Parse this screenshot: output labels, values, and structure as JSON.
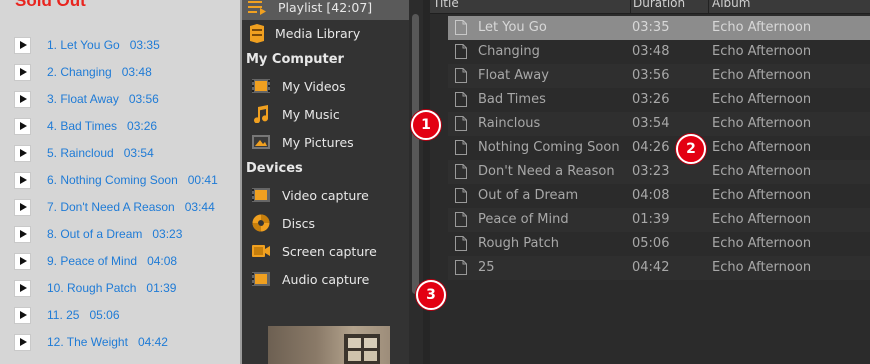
{
  "web_panel": {
    "title": "Sold Out",
    "tracks": [
      {
        "label": "1. Let You Go",
        "duration": "03:35"
      },
      {
        "label": "2. Changing",
        "duration": "03:48"
      },
      {
        "label": "3. Float Away",
        "duration": "03:56"
      },
      {
        "label": "4. Bad Times",
        "duration": "03:26"
      },
      {
        "label": "5. Raincloud",
        "duration": "03:54"
      },
      {
        "label": "6. Nothing Coming Soon",
        "duration": "00:41"
      },
      {
        "label": "7. Don't Need A Reason",
        "duration": "03:44"
      },
      {
        "label": "8. Out of a Dream",
        "duration": "03:23"
      },
      {
        "label": "9. Peace of Mind",
        "duration": "04:08"
      },
      {
        "label": "10. Rough Patch",
        "duration": "01:39"
      },
      {
        "label": "11. 25",
        "duration": "05:06"
      },
      {
        "label": "12. The Weight",
        "duration": "04:42"
      }
    ]
  },
  "sidebar": {
    "playlist": "Playlist [42:07]",
    "media_library": "Media Library",
    "my_computer_heading": "My Computer",
    "my_videos": "My Videos",
    "my_music": "My Music",
    "my_pictures": "My Pictures",
    "devices_heading": "Devices",
    "video_capture": "Video capture",
    "discs": "Discs",
    "screen_capture": "Screen capture",
    "audio_capture": "Audio capture"
  },
  "playlist": {
    "columns": {
      "title": "Title",
      "duration": "Duration",
      "album": "Album"
    },
    "rows": [
      {
        "title": "Let You Go",
        "duration": "03:35",
        "album": "Echo Afternoon"
      },
      {
        "title": "Changing",
        "duration": "03:48",
        "album": "Echo Afternoon"
      },
      {
        "title": "Float Away",
        "duration": "03:56",
        "album": "Echo Afternoon"
      },
      {
        "title": "Bad Times",
        "duration": "03:26",
        "album": "Echo Afternoon"
      },
      {
        "title": "Rainclous",
        "duration": "03:54",
        "album": "Echo Afternoon"
      },
      {
        "title": "Nothing Coming Soon",
        "duration": "04:26",
        "album": "Echo Afternoon"
      },
      {
        "title": "Don't Need a Reason",
        "duration": "03:23",
        "album": "Echo Afternoon"
      },
      {
        "title": "Out of a Dream",
        "duration": "04:08",
        "album": "Echo Afternoon"
      },
      {
        "title": "Peace of Mind",
        "duration": "01:39",
        "album": "Echo Afternoon"
      },
      {
        "title": "Rough Patch",
        "duration": "05:06",
        "album": "Echo Afternoon"
      },
      {
        "title": "25",
        "duration": "04:42",
        "album": "Echo Afternoon"
      }
    ]
  },
  "markers": [
    "1",
    "2",
    "3"
  ],
  "colors": {
    "accent": "#f0a020",
    "marker": "#e30012",
    "link": "#1f7bd6",
    "title_red": "#e8251f"
  }
}
